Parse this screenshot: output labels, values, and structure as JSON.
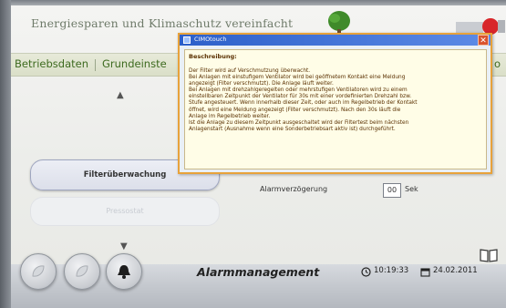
{
  "header": {
    "app_title": "Energiesparen und Klimaschutz vereinfacht"
  },
  "nav": {
    "items": [
      "Betriebsdaten",
      "Grundeinste"
    ],
    "right_fragment": "o"
  },
  "dialog": {
    "window_title": "CIMOtouch",
    "heading": "Beschreibung:",
    "lines": [
      "Der Filter wird auf Verschmutzung überwacht.",
      "Bei Anlagen mit einstufigem Ventilator wird bei geöffnetem Kontakt eine Meldung",
      "angezeigt (Filter verschmutzt). Die Anlage läuft weiter.",
      "Bei Anlagen mit drehzahlgeregelten oder mehrstufigen Ventilatoren wird zu einem",
      "einstellbaren Zeitpunkt der Ventilator für 30s mit einer vordefinierten Drehzahl bzw.",
      "Stufe angesteuert. Wenn innerhalb dieser Zeit, oder auch im Regelbetrieb der Kontakt",
      "öffnet, wird eine Meldung angezeigt (Filter verschmutzt). Nach den 30s läuft die",
      "Anlage im Regelbetrieb weiter.",
      "Ist die Anlage zu diesem Zeitpunkt ausgeschaltet wird der Filtertest beim nächsten",
      "Anlagenstart (Ausnahme wenn eine Sonderbetriebsart aktiv ist) durchgeführt."
    ],
    "close_label": "✕"
  },
  "main": {
    "filter_button": "Filterüberwachung",
    "pressure_button": "Pressostat",
    "delay_label": "Alarmverzögerung",
    "delay_value": "00",
    "delay_unit": "Sek",
    "scroll_up": "▲",
    "scroll_down": "▼"
  },
  "footer": {
    "title": "Alarmmanagement",
    "time": "10:19:33",
    "date": "24.02.2011"
  },
  "colors": {
    "accent_green": "#3d6a1f",
    "dialog_border": "#e8a23a",
    "dialog_title": "#2c5fc9"
  }
}
